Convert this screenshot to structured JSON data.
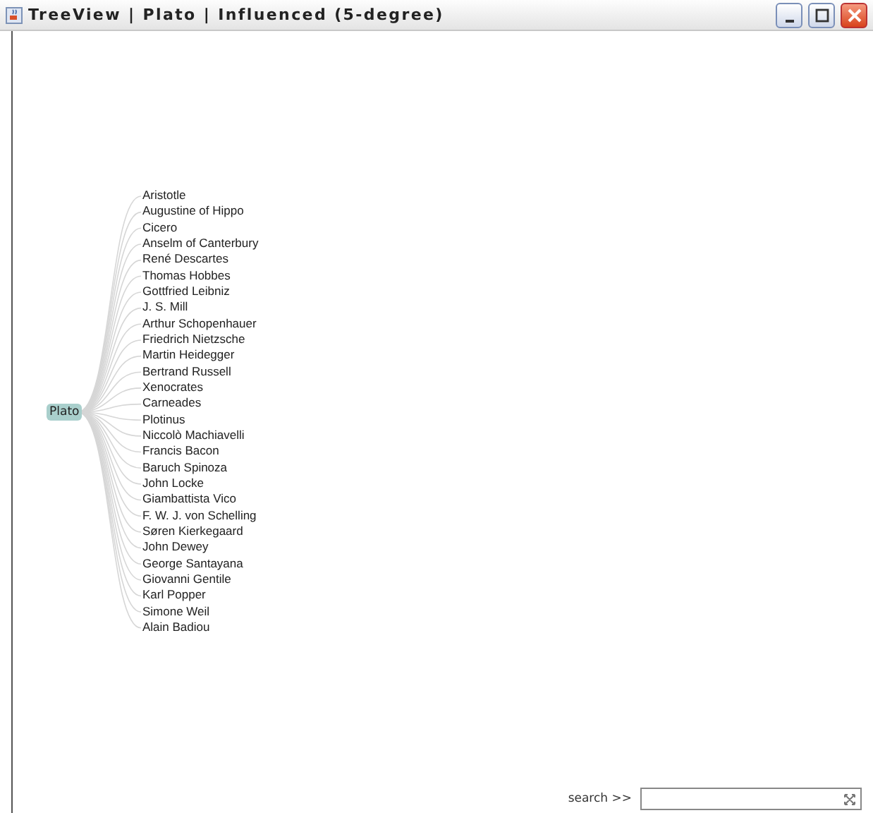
{
  "window": {
    "title": "TreeView | Plato | Influenced (5-degree)"
  },
  "tree": {
    "root": {
      "label": "Plato",
      "selected": true
    },
    "children": [
      {
        "label": "Aristotle"
      },
      {
        "label": "Augustine of Hippo"
      },
      {
        "label": "Cicero"
      },
      {
        "label": "Anselm of Canterbury"
      },
      {
        "label": "René Descartes"
      },
      {
        "label": "Thomas Hobbes"
      },
      {
        "label": "Gottfried Leibniz"
      },
      {
        "label": "J. S. Mill"
      },
      {
        "label": "Arthur Schopenhauer"
      },
      {
        "label": "Friedrich Nietzsche"
      },
      {
        "label": "Martin Heidegger"
      },
      {
        "label": "Bertrand Russell"
      },
      {
        "label": "Xenocrates"
      },
      {
        "label": "Carneades"
      },
      {
        "label": "Plotinus"
      },
      {
        "label": "Niccolò Machiavelli"
      },
      {
        "label": "Francis Bacon"
      },
      {
        "label": "Baruch Spinoza"
      },
      {
        "label": "John Locke"
      },
      {
        "label": "Giambattista Vico"
      },
      {
        "label": "F. W. J. von Schelling"
      },
      {
        "label": "Søren Kierkegaard"
      },
      {
        "label": "John Dewey"
      },
      {
        "label": "George Santayana"
      },
      {
        "label": "Giovanni Gentile"
      },
      {
        "label": "Karl Popper"
      },
      {
        "label": "Simone Weil"
      },
      {
        "label": "Alain Badiou"
      }
    ]
  },
  "search": {
    "label": "search >>"
  }
}
